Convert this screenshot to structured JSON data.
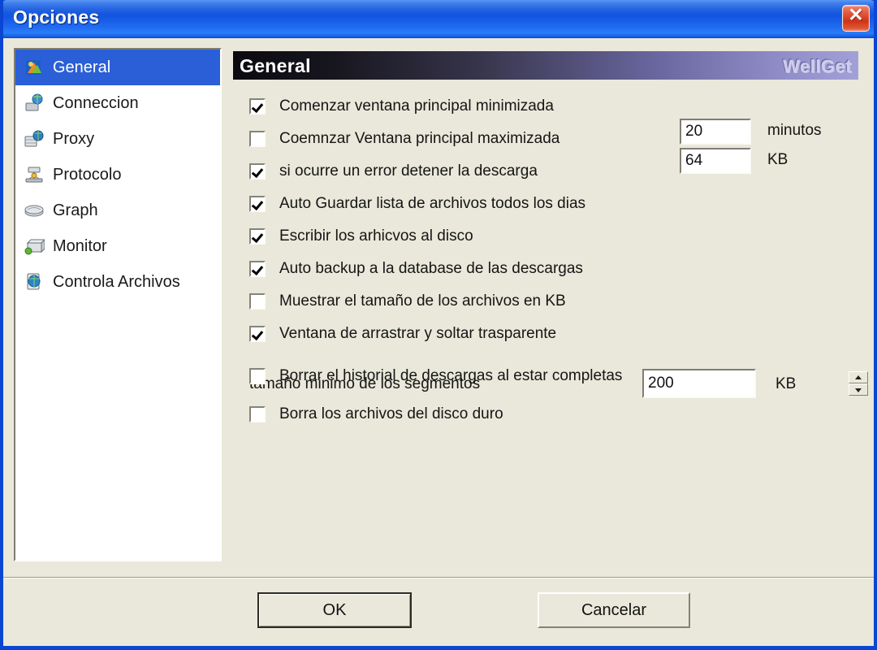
{
  "window": {
    "title": "Opciones",
    "close_label": "✕",
    "close_icon": "close-icon"
  },
  "sidebar": {
    "items": [
      {
        "label": "General",
        "icon": "general-icon",
        "selected": true
      },
      {
        "label": "Conneccion",
        "icon": "connection-icon",
        "selected": false
      },
      {
        "label": "Proxy",
        "icon": "proxy-icon",
        "selected": false
      },
      {
        "label": "Protocolo",
        "icon": "protocol-icon",
        "selected": false
      },
      {
        "label": "Graph",
        "icon": "graph-icon",
        "selected": false
      },
      {
        "label": "Monitor",
        "icon": "monitor-icon",
        "selected": false
      },
      {
        "label": "Controla Archivos",
        "icon": "file-control-icon",
        "selected": false
      }
    ]
  },
  "pane": {
    "header_title": "General",
    "brand": "WellGet",
    "checkboxes": [
      {
        "label": "Comenzar ventana principal minimizada",
        "checked": true
      },
      {
        "label": "Coemnzar Ventana principal maximizada",
        "checked": false
      },
      {
        "label": "si ocurre un error detener la descarga",
        "checked": true
      },
      {
        "label": "Auto Guardar lista de archivos todos los dias",
        "checked": true
      },
      {
        "label": "Escribir los arhicvos al disco",
        "checked": true
      },
      {
        "label": "Auto backup a la database de las descargas",
        "checked": true
      },
      {
        "label": "Muestrar el tamaño de los archivos en KB",
        "checked": false
      },
      {
        "label": "Ventana de arrastrar y soltar trasparente",
        "checked": true
      },
      {
        "label": "Borrar el historial de descargas al estar completas",
        "checked": false
      },
      {
        "label": "Borra los archivos del disco duro",
        "checked": false
      }
    ],
    "fields": {
      "autosave_interval": {
        "value": "20",
        "unit": "minutos"
      },
      "disk_write_buffer": {
        "value": "64",
        "unit": "KB"
      },
      "min_segment_size": {
        "label": "tamaño minimo de los segmentos",
        "value": "200",
        "unit": "KB"
      }
    }
  },
  "footer": {
    "ok_label": "OK",
    "cancel_label": "Cancelar"
  },
  "colors": {
    "titlebar_blue": "#0a46d2",
    "dialog_face": "#e9e8da",
    "selection_blue": "#2a5fd8",
    "close_red": "#cf3418"
  }
}
